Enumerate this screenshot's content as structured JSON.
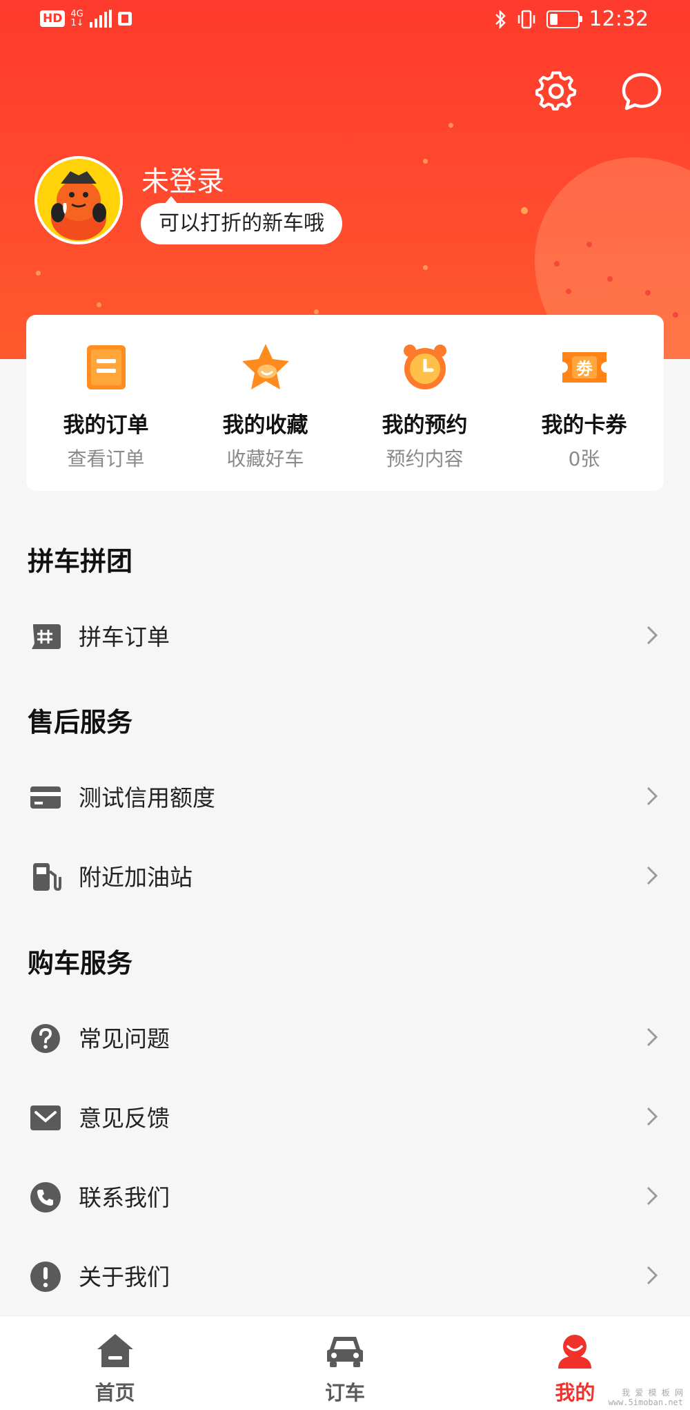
{
  "status_bar": {
    "hd": "HD",
    "network": "4G",
    "network_sub": "1↓",
    "time": "12:32"
  },
  "header": {
    "settings_icon": "gear-icon",
    "message_icon": "chat-bubble-icon",
    "username": "未登录",
    "tagline": "可以打折的新车哦"
  },
  "quick_actions": [
    {
      "title": "我的订单",
      "sub": "查看订单",
      "icon": "order-doc-icon"
    },
    {
      "title": "我的收藏",
      "sub": "收藏好车",
      "icon": "star-icon"
    },
    {
      "title": "我的预约",
      "sub": "预约内容",
      "icon": "alarm-clock-icon"
    },
    {
      "title": "我的卡券",
      "sub": "0张",
      "icon": "coupon-icon",
      "badge": "劵"
    }
  ],
  "sections": [
    {
      "title": "拼车拼团",
      "items": [
        {
          "label": "拼车订单",
          "icon": "group-hash-icon"
        }
      ]
    },
    {
      "title": "售后服务",
      "items": [
        {
          "label": "测试信用额度",
          "icon": "credit-card-icon"
        },
        {
          "label": "附近加油站",
          "icon": "fuel-pump-icon"
        }
      ]
    },
    {
      "title": "购车服务",
      "items": [
        {
          "label": "常见问题",
          "icon": "question-icon"
        },
        {
          "label": "意见反馈",
          "icon": "mail-icon"
        },
        {
          "label": "联系我们",
          "icon": "phone-icon"
        },
        {
          "label": "关于我们",
          "icon": "info-exclamation-icon"
        }
      ]
    }
  ],
  "tabbar": [
    {
      "label": "首页",
      "icon": "home-icon",
      "active": false
    },
    {
      "label": "订车",
      "icon": "car-icon",
      "active": false
    },
    {
      "label": "我的",
      "icon": "profile-icon",
      "active": true
    }
  ],
  "watermark": {
    "line1": "我 爱 模 板 网",
    "line2": "www.5imoban.net"
  },
  "colors": {
    "brand": "#fe3a2c",
    "accent_orange": "#ff8a1e",
    "text_gray": "#8a8a8a",
    "icon_gray": "#5a5a5a"
  }
}
